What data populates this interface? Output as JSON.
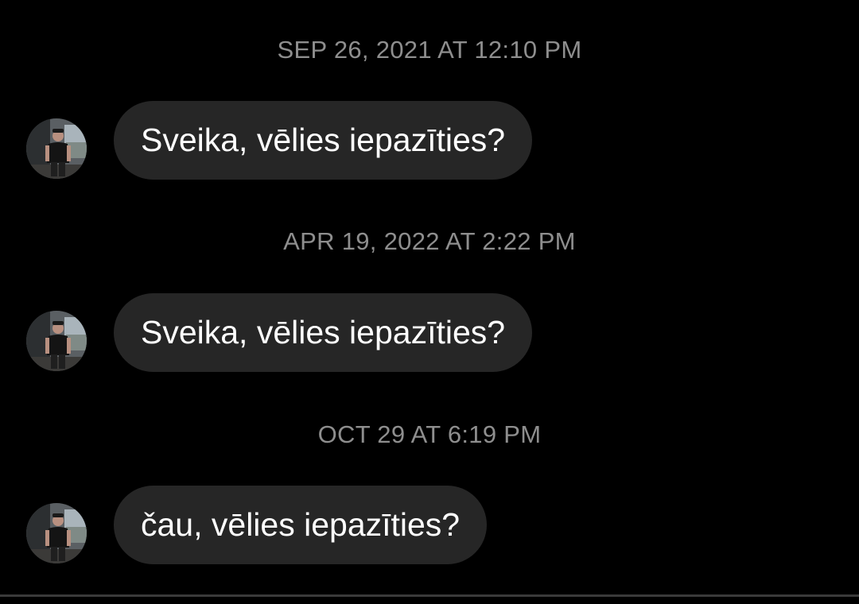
{
  "colors": {
    "background": "#000000",
    "timestamp_text": "#8e8e8e",
    "bubble_background": "#262626",
    "bubble_text": "#ffffff"
  },
  "messages": [
    {
      "timestamp": "SEP 26, 2021 AT 12:10 PM",
      "text": "Sveika, vēlies iepazīties?",
      "avatar_icon": "user-avatar-photo"
    },
    {
      "timestamp": "APR 19, 2022 AT 2:22 PM",
      "text": "Sveika, vēlies iepazīties?",
      "avatar_icon": "user-avatar-photo"
    },
    {
      "timestamp": "OCT 29 AT 6:19 PM",
      "text": "čau, vēlies iepazīties?",
      "avatar_icon": "user-avatar-photo"
    }
  ]
}
